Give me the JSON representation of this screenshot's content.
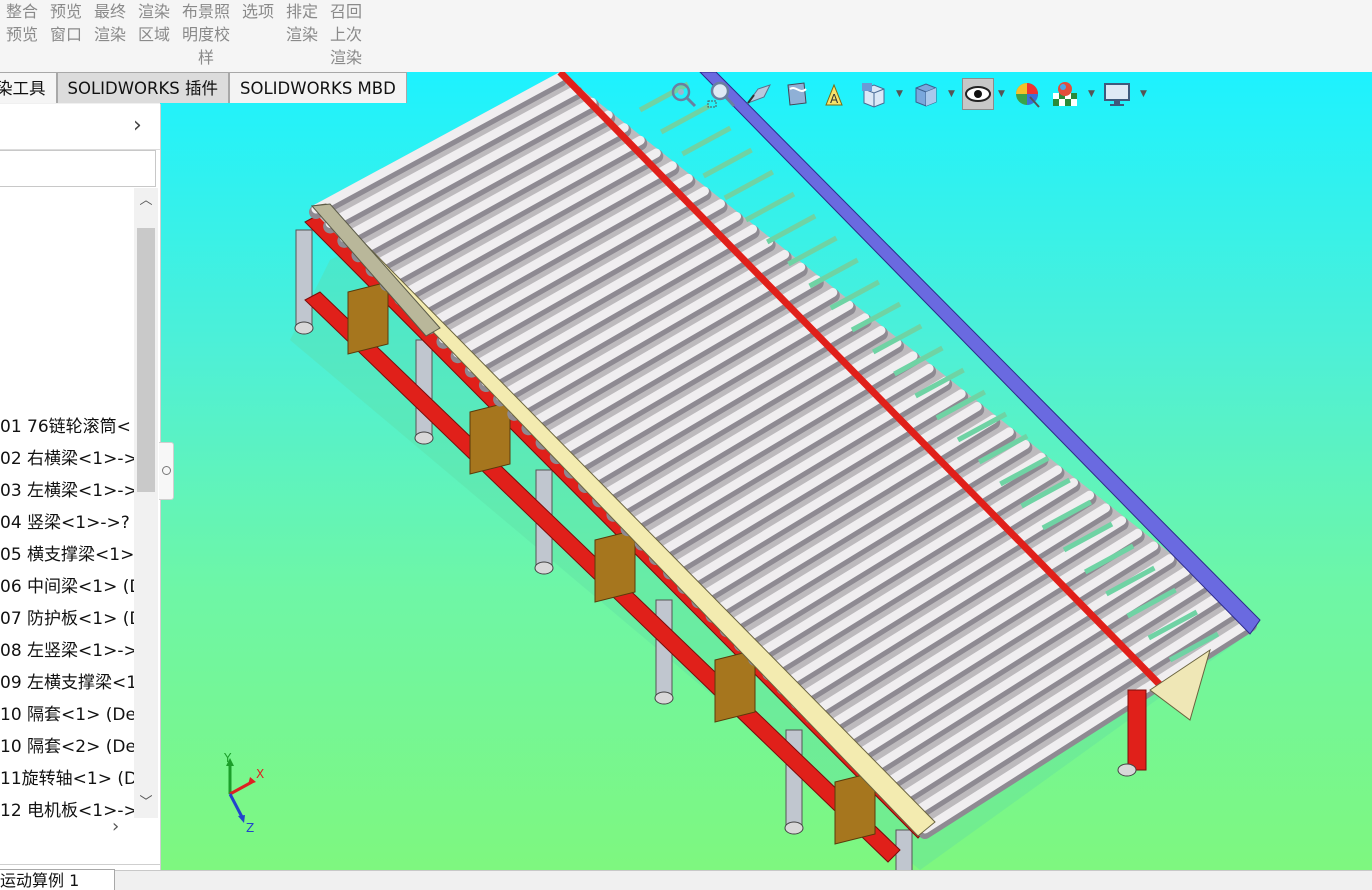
{
  "ribbon": {
    "commands": [
      {
        "lines": [
          "整合",
          "预览"
        ]
      },
      {
        "lines": [
          "预览",
          "窗口"
        ]
      },
      {
        "lines": [
          "最终",
          "渲染"
        ]
      },
      {
        "lines": [
          "渲染",
          "区域"
        ]
      },
      {
        "lines": [
          "布景照",
          "明度校",
          "样"
        ]
      },
      {
        "lines": [
          "选项"
        ]
      },
      {
        "lines": [
          "排定",
          "渲染"
        ]
      },
      {
        "lines": [
          "召回",
          "上次",
          "渲染"
        ]
      }
    ]
  },
  "tabs": [
    {
      "label": "染工具"
    },
    {
      "label": "SOLIDWORKS 插件"
    },
    {
      "label": "SOLIDWORKS MBD"
    }
  ],
  "tree": {
    "items": [
      "01 76链轮滚筒<",
      "02 右横梁<1>->",
      "03 左横梁<1>->",
      "04 竖梁<1>->?",
      "05 横支撑梁<1>",
      "06 中间梁<1> (D",
      "07 防护板<1> (D",
      "08 左竖梁<1>->",
      "09 左横支撑梁<1",
      "10 隔套<1> (De",
      "10 隔套<2> (De",
      "11旋转轴<1> (D",
      "12 电机板<1>->"
    ]
  },
  "bottom_tab": {
    "label": "运动算例 1"
  },
  "triad": {
    "x": "X",
    "y": "Y",
    "z": "Z"
  },
  "hud_icons": [
    "zoom-to-fit-icon",
    "zoom-to-area-icon",
    "previous-view-icon",
    "section-view-icon",
    "dynamic-annotation-icon",
    "view-orientation-icon",
    "display-style-icon",
    "hide-show-items-icon",
    "edit-appearance-icon",
    "apply-scene-icon",
    "view-settings-icon"
  ],
  "colors": {
    "viewport_top": "#1df2ff",
    "viewport_bottom": "#7ef77f",
    "frame_red": "#e0201a",
    "rail_yellow": "#f3ebb0",
    "side_blue": "#6a6ae0",
    "roller_white": "#f0eef0"
  }
}
